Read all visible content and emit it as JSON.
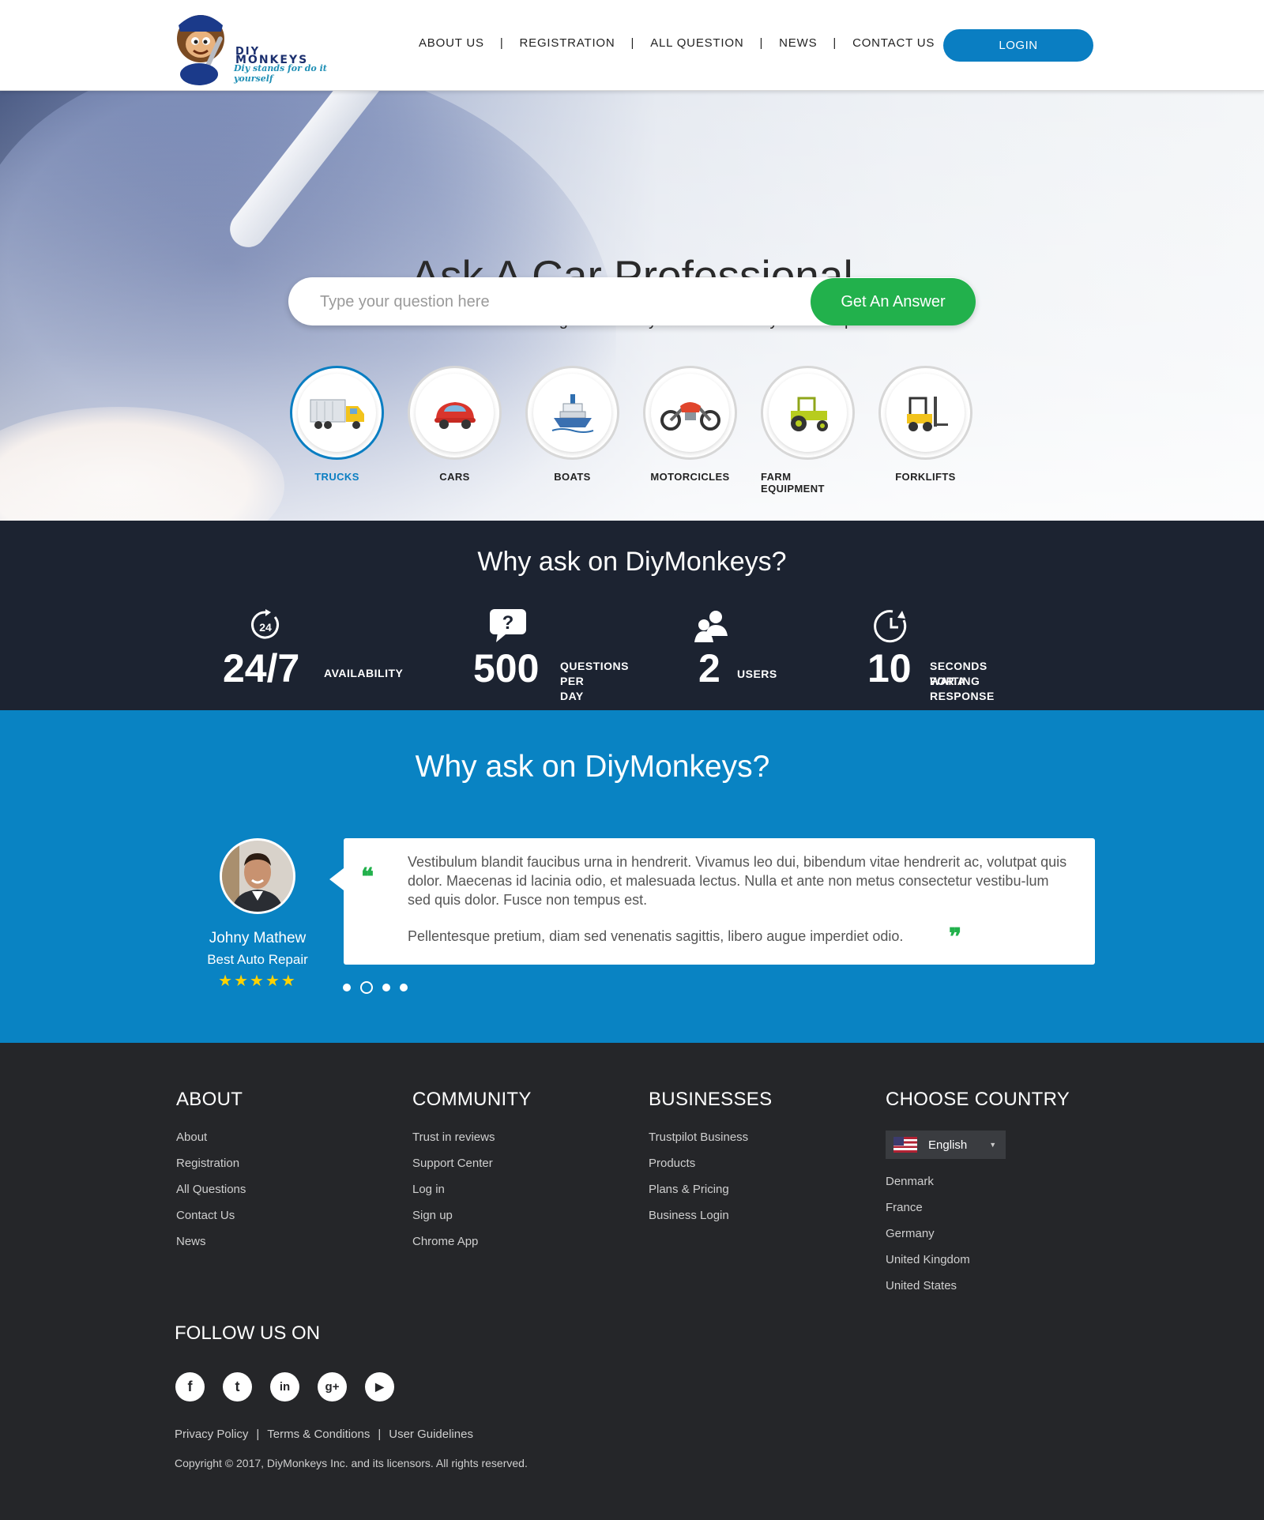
{
  "header": {
    "logo": {
      "line1": "DIY",
      "line2": "MONKEYS",
      "tagline": "Diy stands for do it yourself"
    },
    "nav": [
      "ABOUT US",
      "REGISTRATION",
      "ALL QUESTION",
      "NEWS",
      "CONTACT US"
    ],
    "nav_separator": "|",
    "login_label": "LOGIN"
  },
  "hero": {
    "title": "Ask A Car Professional",
    "subtitle": "Because a little knowledge can save you a lot of money on  car repair.",
    "search_placeholder": "Type your question here",
    "answer_button": "Get An Answer",
    "categories": [
      {
        "label": "TRUCKS",
        "icon": "truck-icon",
        "active": true
      },
      {
        "label": "CARS",
        "icon": "car-icon",
        "active": false
      },
      {
        "label": "BOATS",
        "icon": "boat-icon",
        "active": false
      },
      {
        "label": "MOTORCICLES",
        "icon": "motorcycle-icon",
        "active": false
      },
      {
        "label": "FARM EQUIPMENT",
        "icon": "tractor-icon",
        "active": false
      },
      {
        "label": "FORKLIFTS",
        "icon": "forklift-icon",
        "active": false
      }
    ]
  },
  "stats": {
    "title": "Why ask on DiyMonkeys?",
    "items": [
      {
        "number": "24/7",
        "label_line1": "AVAILABILITY",
        "label_line2": "",
        "icon": "24-hours-icon"
      },
      {
        "number": "500",
        "label_line1": "QUESTIONS",
        "label_line2": "PER DAY",
        "icon": "question-bubble-icon"
      },
      {
        "number": "2",
        "label_line1": "USERS",
        "label_line2": "",
        "icon": "users-icon"
      },
      {
        "number": "10",
        "label_line1": "SECONDS WAITING",
        "label_line2": "FOR A RESPONSE",
        "icon": "clock-icon"
      }
    ]
  },
  "testimonials": {
    "title": "Why ask on DiyMonkeys?",
    "person": {
      "name": "Johny Mathew",
      "company": "Best Auto Repair",
      "stars": "★★★★★",
      "rating": 5
    },
    "quote_p1": "Vestibulum blandit faucibus urna in hendrerit. Vivamus leo dui, bibendum vitae hendrerit ac, volutpat quis dolor. Maecenas id lacinia odio, et malesuada lectus. Nulla et ante non metus consectetur vestibu-lum sed quis dolor. Fusce non tempus est.",
    "quote_p2": "Pellentesque pretium, diam sed venenatis sagittis, libero augue imperdiet odio.",
    "open_quote": "❝",
    "close_quote": "❞",
    "active_dot": 2,
    "dot_count": 4
  },
  "footer": {
    "about": {
      "title": "ABOUT",
      "links": [
        "About",
        "Registration",
        "All Questions",
        "Contact Us",
        "News"
      ]
    },
    "community": {
      "title": "COMMUNITY",
      "links": [
        "Trust in reviews",
        "Support Center",
        "Log in",
        "Sign up",
        "Chrome App"
      ]
    },
    "businesses": {
      "title": "BUSINESSES",
      "links": [
        "Trustpilot Business",
        "Products",
        "Plans & Pricing",
        "Business Login"
      ]
    },
    "country": {
      "title": "CHOOSE COUNTRY",
      "selected": "English",
      "options": [
        "Denmark",
        "France",
        "Germany",
        "United Kingdom",
        "United States"
      ]
    },
    "follow_title": "FOLLOW US ON",
    "socials": [
      {
        "name": "facebook-icon",
        "glyph": "f"
      },
      {
        "name": "twitter-icon",
        "glyph": "t"
      },
      {
        "name": "linkedin-icon",
        "glyph": "in"
      },
      {
        "name": "google-plus-icon",
        "glyph": "g+"
      },
      {
        "name": "youtube-icon",
        "glyph": "▶"
      }
    ],
    "legal": [
      "Privacy Policy",
      "Terms & Conditions",
      "User Guidelines"
    ],
    "copyright": "Copyright © 2017, DiyMonkeys Inc. and its licensors. All rights reserved."
  }
}
